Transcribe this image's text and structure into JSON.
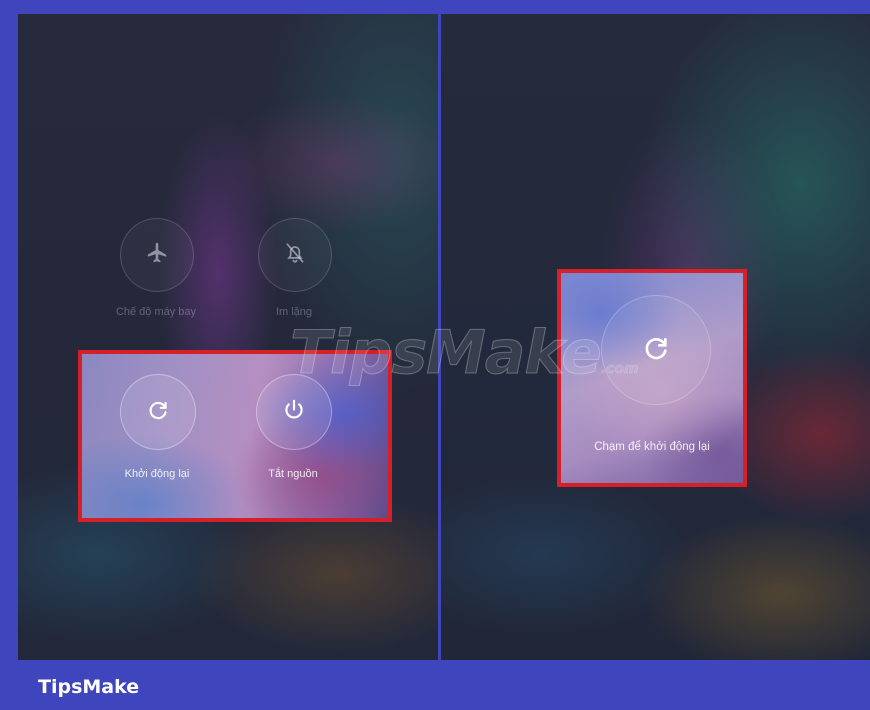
{
  "footer": {
    "brand": "TipsMake"
  },
  "watermark": {
    "main": "TipsMake",
    "suffix": ".com"
  },
  "colors": {
    "frame": "#3f46bd",
    "highlight_border": "#d5202a"
  },
  "left_panel": {
    "top_buttons": [
      {
        "icon": "airplane-icon",
        "label": "Chế độ máy bay"
      },
      {
        "icon": "bell-off-icon",
        "label": "Im lặng"
      }
    ],
    "highlighted_buttons": [
      {
        "icon": "restart-icon",
        "label": "Khởi động lại"
      },
      {
        "icon": "power-icon",
        "label": "Tắt nguồn"
      }
    ]
  },
  "right_panel": {
    "confirm_button": {
      "icon": "restart-icon",
      "label": "Chạm để khởi động lại"
    }
  }
}
